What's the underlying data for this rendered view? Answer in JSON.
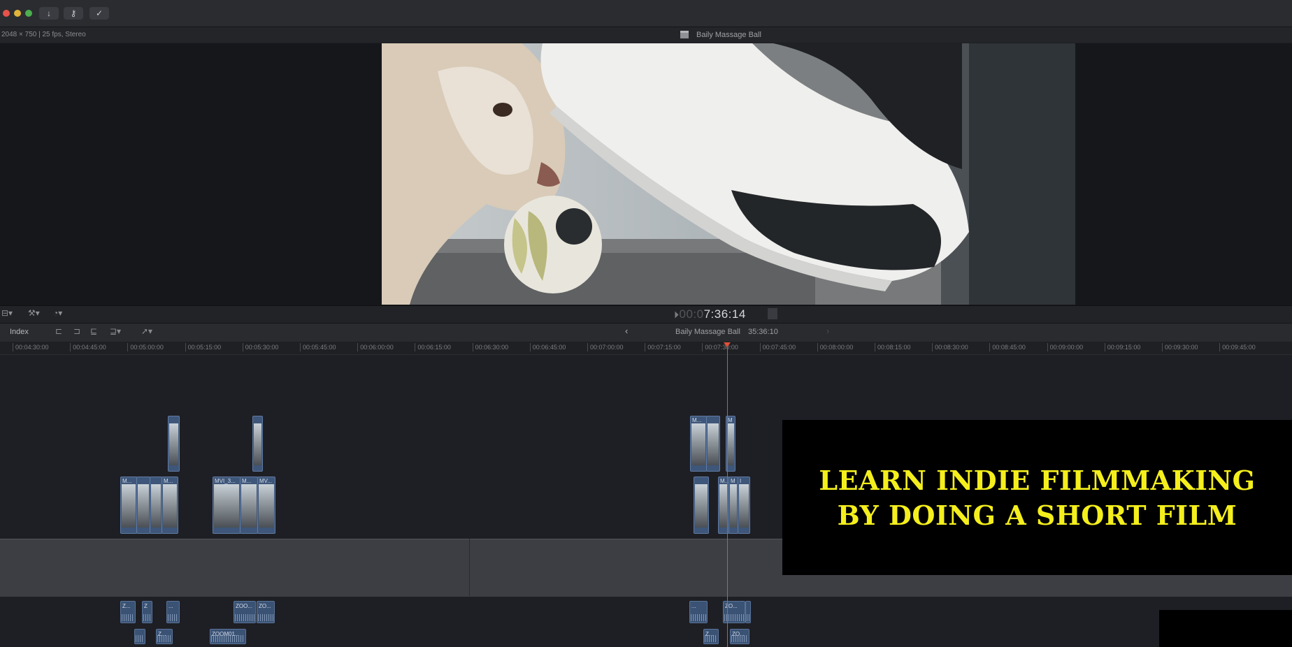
{
  "toolbar": {
    "import_icon": "download-arrow",
    "keyword_icon": "key",
    "check_icon": "checkmark-circle"
  },
  "viewer": {
    "format_info": "2048 × 750 | 25 fps, Stereo",
    "clip_title": "Baily Massage Ball",
    "timecode_dim": "00:0",
    "timecode": "7:36:14"
  },
  "timeline": {
    "index_label": "Index",
    "project_name": "Baily Massage Ball",
    "project_duration": "35:36:10",
    "ruler": [
      "00:04:30:00",
      "00:04:45:00",
      "00:05:00:00",
      "00:05:15:00",
      "00:05:30:00",
      "00:05:45:00",
      "00:06:00:00",
      "00:06:15:00",
      "00:06:30:00",
      "00:06:45:00",
      "00:07:00:00",
      "00:07:15:00",
      "00:07:30:00",
      "00:07:45:00",
      "00:08:00:00",
      "00:08:15:00",
      "00:08:30:00",
      "00:08:45:00",
      "00:09:00:00",
      "00:09:15:00",
      "00:09:30:00",
      "00:09:45:00"
    ],
    "video_clips": [
      "M...",
      "M...",
      "MVI_3...",
      "M...",
      "MV...",
      "M...",
      "M",
      "M...",
      "M",
      "I"
    ],
    "audio_clips": [
      "Z...",
      "Z",
      "...",
      "ZOO...",
      "ZO...",
      "ZOOM01...",
      "Z...",
      "ZO...",
      "Z...",
      "ZO...",
      "Z..."
    ]
  },
  "banner": {
    "line1": "LEARN INDIE FILMMAKING",
    "line2": "BY DOING A SHORT FILM"
  }
}
